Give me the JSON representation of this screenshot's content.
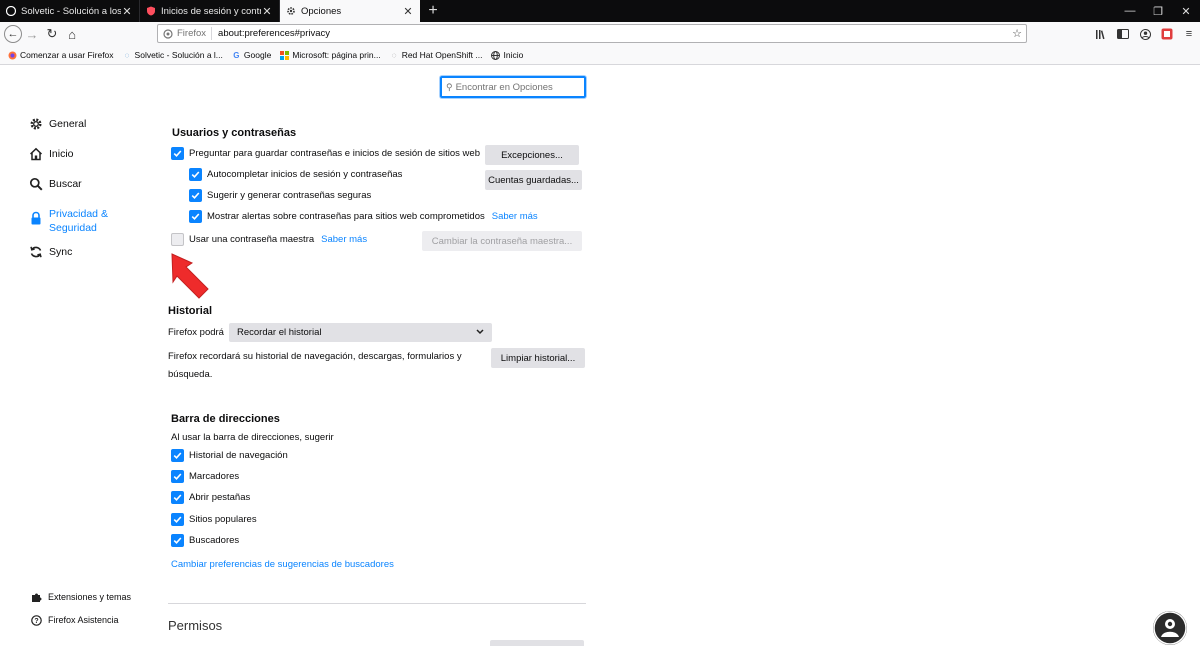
{
  "tabs": [
    {
      "title": "Solvetic - Solución a los proble",
      "icon": "solvetic-icon",
      "active": false
    },
    {
      "title": "Inicios de sesión y contraseñas",
      "icon": "lockwise-icon",
      "active": false
    },
    {
      "title": "Opciones",
      "icon": "gear-icon",
      "active": true
    }
  ],
  "urlbar": {
    "identity_label": "Firefox",
    "url": "about:preferences#privacy"
  },
  "bookmarks": [
    {
      "label": "Comenzar a usar Firefox",
      "icon": "firefox-icon"
    },
    {
      "label": "Solvetic - Solución a l...",
      "icon": "solvetic-icon"
    },
    {
      "label": "Google",
      "icon": "google-icon"
    },
    {
      "label": "Microsoft: página prin...",
      "icon": "microsoft-icon"
    },
    {
      "label": "Red Hat OpenShift ...",
      "icon": "redhat-icon"
    },
    {
      "label": "Inicio",
      "icon": "globe-icon"
    }
  ],
  "search": {
    "placeholder": "Encontrar en Opciones"
  },
  "sidebar": {
    "items": [
      {
        "label": "General",
        "icon": "gear-icon"
      },
      {
        "label": "Inicio",
        "icon": "home-icon"
      },
      {
        "label": "Buscar",
        "icon": "search-icon"
      },
      {
        "label": "Privacidad & Seguridad",
        "icon": "lock-icon",
        "selected": true
      },
      {
        "label": "Sync",
        "icon": "sync-icon"
      }
    ],
    "footer": [
      {
        "label": "Extensiones y temas",
        "icon": "puzzle-icon"
      },
      {
        "label": "Firefox Asistencia",
        "icon": "help-circle-icon"
      }
    ]
  },
  "logins": {
    "title": "Usuarios y contraseñas",
    "ask_save": "Preguntar para guardar contraseñas e inicios de sesión de sitios web",
    "autofill": "Autocompletar inicios de sesión y contraseñas",
    "suggest": "Sugerir y generar contraseñas seguras",
    "alerts": "Mostrar alertas sobre contraseñas para sitios web comprometidos",
    "alerts_link": "Saber más",
    "master": "Usar una contraseña maestra",
    "master_link": "Saber más",
    "exceptions_btn": "Excepciones...",
    "saved_btn": "Cuentas guardadas...",
    "change_master_btn": "Cambiar la contraseña maestra...",
    "master_checked": false
  },
  "history": {
    "title": "Historial",
    "will_label": "Firefox podrá",
    "select_value": "Recordar el historial",
    "desc_line1": "Firefox recordará su historial de navegación, descargas, formularios y",
    "desc_line2": "búsqueda.",
    "clear_btn": "Limpiar historial..."
  },
  "addressbar": {
    "title": "Barra de direcciones",
    "subtitle": "Al usar la barra de direcciones, sugerir",
    "options": [
      {
        "label": "Historial de navegación",
        "checked": true
      },
      {
        "label": "Marcadores",
        "checked": true
      },
      {
        "label": "Abrir pestañas",
        "checked": true
      },
      {
        "label": "Sitios populares",
        "checked": true
      },
      {
        "label": "Buscadores",
        "checked": true
      }
    ],
    "change_link": "Cambiar preferencias de sugerencias de buscadores"
  },
  "permissions": {
    "title": "Permisos"
  },
  "colors": {
    "accent": "#0a84ff",
    "arrow": "#ee2b2b",
    "tabbar": "#0c0c0d"
  }
}
